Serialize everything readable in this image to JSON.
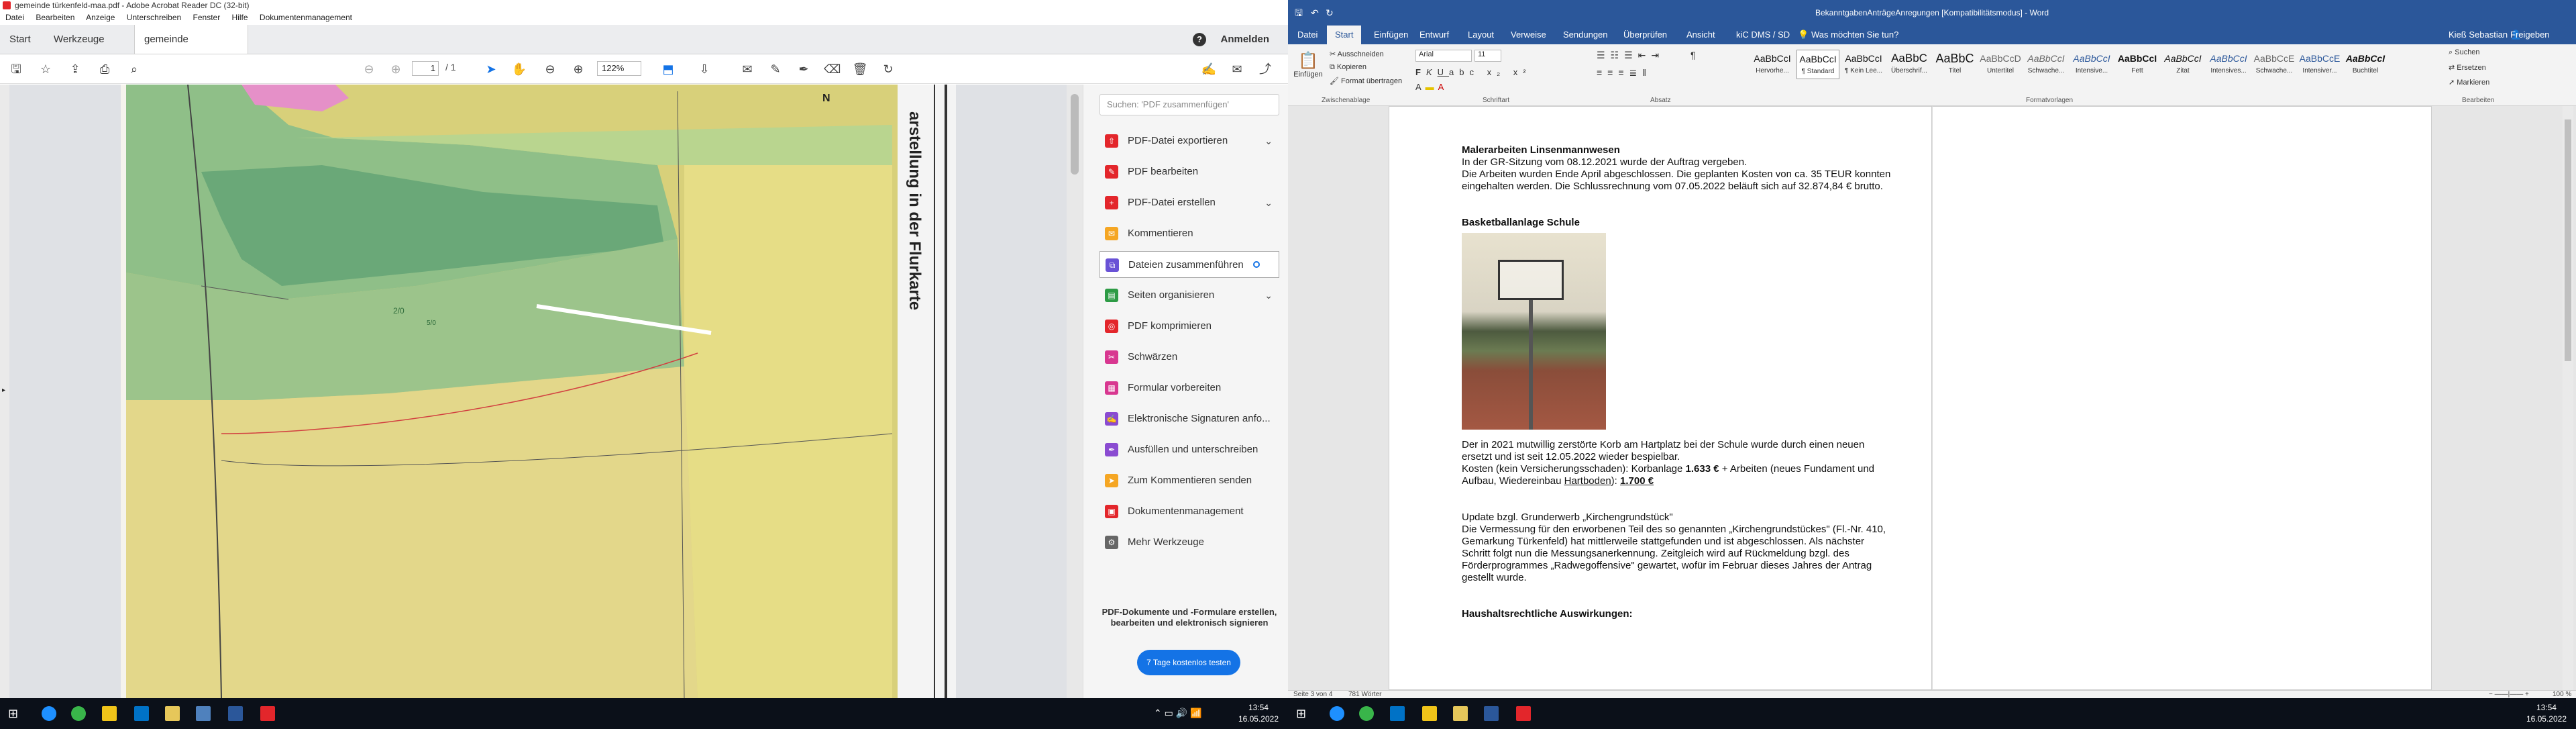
{
  "acrobat": {
    "window_title": "gemeinde türkenfeld-maa.pdf - Adobe Acrobat Reader DC (32-bit)",
    "menu": [
      "Datei",
      "Bearbeiten",
      "Anzeige",
      "Unterschreiben",
      "Fenster",
      "Hilfe",
      "Dokumentenmanagement"
    ],
    "tabs": {
      "home": "Start",
      "tools": "Werkzeuge",
      "doc": "gemeinde türkenfel..."
    },
    "help_label": "?",
    "signin": "Anmelden",
    "page_current": "1",
    "page_total": "/ 1",
    "zoom": "122%",
    "map_heading": "arstellung in der Flurkarte",
    "map_labels": [
      "N",
      "2/0",
      "5/0"
    ],
    "search_placeholder": "Suchen: 'PDF zusammenfügen'",
    "tools": [
      {
        "label": "PDF-Datei exportieren",
        "color": "#e3262b",
        "chevron": true
      },
      {
        "label": "PDF bearbeiten",
        "color": "#e3262b",
        "chevron": false
      },
      {
        "label": "PDF-Datei erstellen",
        "color": "#e3262b",
        "chevron": true
      },
      {
        "label": "Kommentieren",
        "color": "#f5a623",
        "chevron": false
      },
      {
        "label": "Dateien zusammenführen",
        "color": "#6952d6",
        "chevron": false,
        "selected": true
      },
      {
        "label": "Seiten organisieren",
        "color": "#2d9b45",
        "chevron": true
      },
      {
        "label": "PDF komprimieren",
        "color": "#e3262b",
        "chevron": false
      },
      {
        "label": "Schwärzen",
        "color": "#d83790",
        "chevron": false
      },
      {
        "label": "Formular vorbereiten",
        "color": "#d83790",
        "chevron": false
      },
      {
        "label": "Elektronische Signaturen anfo...",
        "color": "#8a4bd1",
        "chevron": false
      },
      {
        "label": "Ausfüllen und unterschreiben",
        "color": "#8a4bd1",
        "chevron": false
      },
      {
        "label": "Zum Kommentieren senden",
        "color": "#f5a623",
        "chevron": false
      },
      {
        "label": "Dokumentenmanagement",
        "color": "#e3262b",
        "chevron": false
      },
      {
        "label": "Mehr Werkzeuge",
        "color": "#666",
        "chevron": false
      }
    ],
    "promo_text": "PDF-Dokumente und -Formulare erstellen, bearbeiten und elektronisch signieren",
    "trial_button": "7 Tage kostenlos testen"
  },
  "word": {
    "window_title": "BekanntgabenAnträgeAnregungen [Kompatibilitätsmodus] - Word",
    "tabs": [
      "Datei",
      "Start",
      "Einfügen",
      "Entwurf",
      "Layout",
      "Verweise",
      "Sendungen",
      "Überprüfen",
      "Ansicht",
      "kiC DMS / SD"
    ],
    "tell_me": "Was möchten Sie tun?",
    "user": "Kieß Sebastian",
    "share": "Freigeben",
    "clipboard": {
      "paste": "Einfügen",
      "cut": "Ausschneiden",
      "copy": "Kopieren",
      "format": "Format übertragen",
      "group": "Zwischenablage"
    },
    "font": {
      "name": "Arial",
      "size": "11",
      "group": "Schriftart"
    },
    "paragraph_group": "Absatz",
    "styles": [
      {
        "sample": "AaBbCcI",
        "name": "Hervorhe..."
      },
      {
        "sample": "AaBbCcI",
        "name": "¶ Standard",
        "selected": true
      },
      {
        "sample": "AaBbCcI",
        "name": "¶ Kein Lee..."
      },
      {
        "sample": "AaBbC",
        "name": "Überschrif..."
      },
      {
        "sample": "AaBbC",
        "name": "Titel"
      },
      {
        "sample": "AaBbCcD",
        "name": "Untertitel"
      },
      {
        "sample": "AaBbCcI",
        "name": "Schwache..."
      },
      {
        "sample": "AaBbCcI",
        "name": "Intensive..."
      },
      {
        "sample": "AaBbCcI",
        "name": "Fett"
      },
      {
        "sample": "AaBbCcI",
        "name": "Zitat"
      },
      {
        "sample": "AaBbCcI",
        "name": "Intensives..."
      },
      {
        "sample": "AaBbCcE",
        "name": "Schwache..."
      },
      {
        "sample": "AaBbCcE",
        "name": "Intensiver..."
      },
      {
        "sample": "AaBbCcI",
        "name": "Buchtitel"
      }
    ],
    "styles_group": "Formatvorlagen",
    "editing": {
      "find": "Suchen",
      "replace": "Ersetzen",
      "select": "Markieren",
      "group": "Bearbeiten"
    },
    "doc": {
      "h1": "Malerarbeiten Linsenmannwesen",
      "p1": "In der GR-Sitzung vom 08.12.2021 wurde der Auftrag vergeben.",
      "p2": "Die Arbeiten wurden Ende April abgeschlossen. Die geplanten Kosten von ca. 35 TEUR konnten eingehalten werden. Die Schlussrechnung vom 07.05.2022 beläuft sich auf 32.874,84 € brutto.",
      "h2": "Basketballanlage Schule",
      "p3": "Der in 2021 mutwillig zerstörte Korb am Hartplatz bei der Schule wurde durch einen neuen ersetzt und ist seit 12.05.2022 wieder bespielbar.",
      "p4a": "Kosten (kein Versicherungsschaden): Korbanlage ",
      "p4b": "1.633 €",
      "p4c": " + Arbeiten (neues Fundament und Aufbau, Wiedereinbau ",
      "p4d": "Hartboden",
      "p4e": "): ",
      "p4f": "1.700 €",
      "p5": "Update bzgl. Grunderwerb „Kirchengrundstück\"",
      "p6": "Die Vermessung für den erworbenen Teil des so genannten „Kirchengrundstückes\" (Fl.-Nr. 410, Gemarkung Türkenfeld) hat mittlerweile stattgefunden und ist abgeschlossen. Als nächster Schritt folgt nun die Messungsanerkennung. Zeitgleich wird auf Rückmeldung bzgl. des Förderprogrammes „Radwegoffensive\" gewartet, wofür im Februar dieses Jahres der Antrag gestellt wurde.",
      "h3": "Haushaltsrechtliche Auswirkungen:"
    },
    "status": {
      "page": "Seite 3 von 4",
      "words": "781 Wörter",
      "zoom": "100 %"
    }
  },
  "taskbar": {
    "time": "13:54",
    "date": "16.05.2022"
  }
}
